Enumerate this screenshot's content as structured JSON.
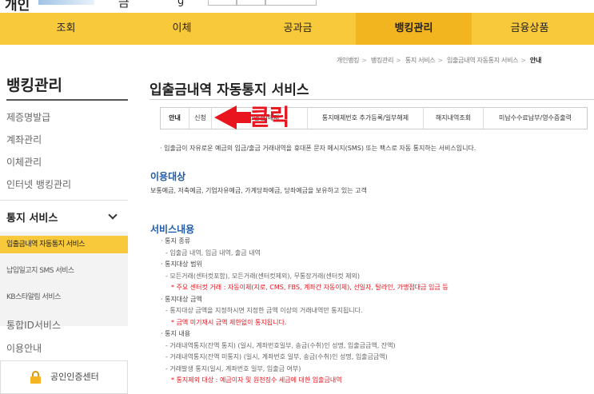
{
  "header": {
    "logo_text": "개인",
    "title_frag": "금",
    "frag3": "g"
  },
  "nav": [
    {
      "label": "조회",
      "active": false
    },
    {
      "label": "이체",
      "active": false
    },
    {
      "label": "공과금",
      "active": false
    },
    {
      "label": "뱅킹관리",
      "active": true
    },
    {
      "label": "금융상품",
      "active": false
    }
  ],
  "sidebar": {
    "title": "뱅킹관리",
    "items": [
      "제증명발급",
      "계좌관리",
      "이체관리",
      "인터넷 뱅킹관리"
    ],
    "group": "통지 서비스",
    "sub_items": [
      "입출금내역 자동통지 서비스",
      "납입일고지 SMS 서비스",
      "KB스타알림 서비스"
    ],
    "after_items": [
      "통합ID서비스",
      "이용안내"
    ],
    "cert_label": "공인인증센터"
  },
  "breadcrumb": [
    "개인뱅킹",
    "뱅킹관리",
    "통지 서비스",
    "입출금내역 자동통지 서비스",
    "안내"
  ],
  "page_title": "입출금내역 자동통지 서비스",
  "tabs": [
    "안내",
    "신청",
    "취소/변경/해제",
    "통지매체번호 추가등록/일부해제",
    "해지내역조회",
    "미납수수료납부/영수증출력"
  ],
  "annotation": {
    "click_text": "클릭"
  },
  "intro": "· 입출금이 자유로운 예금의 입금/출금 거래내역을 휴대폰 문자 메시지(SMS) 또는 팩스로 자동 통지하는 서비스입니다.",
  "target": {
    "heading": "이용대상",
    "text": "보통예금, 저축예금, 기업자유예금, 가계당좌예금, 당좌예금을 보유하고 있는 고객"
  },
  "service": {
    "heading": "서비스내용",
    "lines": [
      {
        "text": "· 통지 종류",
        "kind": "bullet"
      },
      {
        "text": "- 입출금 내역, 입금 내역, 출금 내역",
        "kind": "sub"
      },
      {
        "text": "· 통지대상 범위",
        "kind": "bullet"
      },
      {
        "text": "- 모든거래(센터컷포함), 모든거래(센터컷제외), 무통장거래(센터컷 제외)",
        "kind": "sub"
      },
      {
        "text": "* 주요 센터컷 거래 : 자동이체(지로, CMS, FBS, 계좌간 자동이체), 선일자, 탈라인, 가맹점대금 입금 등",
        "kind": "red"
      },
      {
        "text": "· 통지대상 금액",
        "kind": "bullet"
      },
      {
        "text": "- 통지대상 금액을 지정하시면 지정한 금액 이상의 거래내역만 통지됩니다.",
        "kind": "sub"
      },
      {
        "text": "* 금액 미기재시 금액 제한없이 통지됩니다.",
        "kind": "red"
      },
      {
        "text": "· 통지 내용",
        "kind": "bullet"
      },
      {
        "text": "- 거래내역통지(잔액 통지) (일시, 계좌번호일부, 송금(수취)인 성명, 입출금금액, 잔액)",
        "kind": "sub"
      },
      {
        "text": "- 거래내역통지(잔액 미통지) (일시, 계좌번호 일부, 송금(수취)인 성명, 입출금금액)",
        "kind": "sub"
      },
      {
        "text": "- 거래발생 통지(일시, 계좌번호 일부, 입출금 여부)",
        "kind": "sub"
      },
      {
        "text": "* 통지제외 대상 : 예금이자 및 원천징수 세금에 대한 입출금내역",
        "kind": "red"
      }
    ]
  },
  "colors": {
    "nav_bg": "#f9c93c",
    "nav_active": "#f2b41f",
    "accent_red": "#e8141e",
    "heading_blue": "#1f5aa8"
  }
}
